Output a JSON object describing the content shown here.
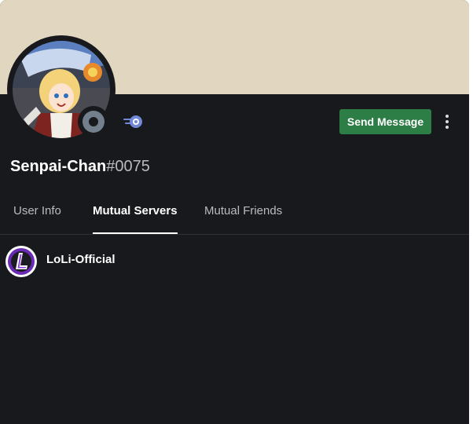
{
  "profile": {
    "username": "Senpai-Chan",
    "discriminator": "#0075",
    "status": "offline",
    "banner_color": "#e1d6c0",
    "avatar_icon": "anime-avatar-icon",
    "badge_icon": "hypesquad-badge-icon"
  },
  "actions": {
    "send_message_label": "Send Message",
    "send_message_color": "#2d7d46",
    "more_icon": "more-vertical-icon"
  },
  "tabs": [
    {
      "label": "User Info",
      "active": false
    },
    {
      "label": "Mutual Servers",
      "active": true
    },
    {
      "label": "Mutual Friends",
      "active": false
    }
  ],
  "mutual_servers": [
    {
      "name": "LoLi-Official",
      "icon": "loli-server-icon"
    }
  ]
}
